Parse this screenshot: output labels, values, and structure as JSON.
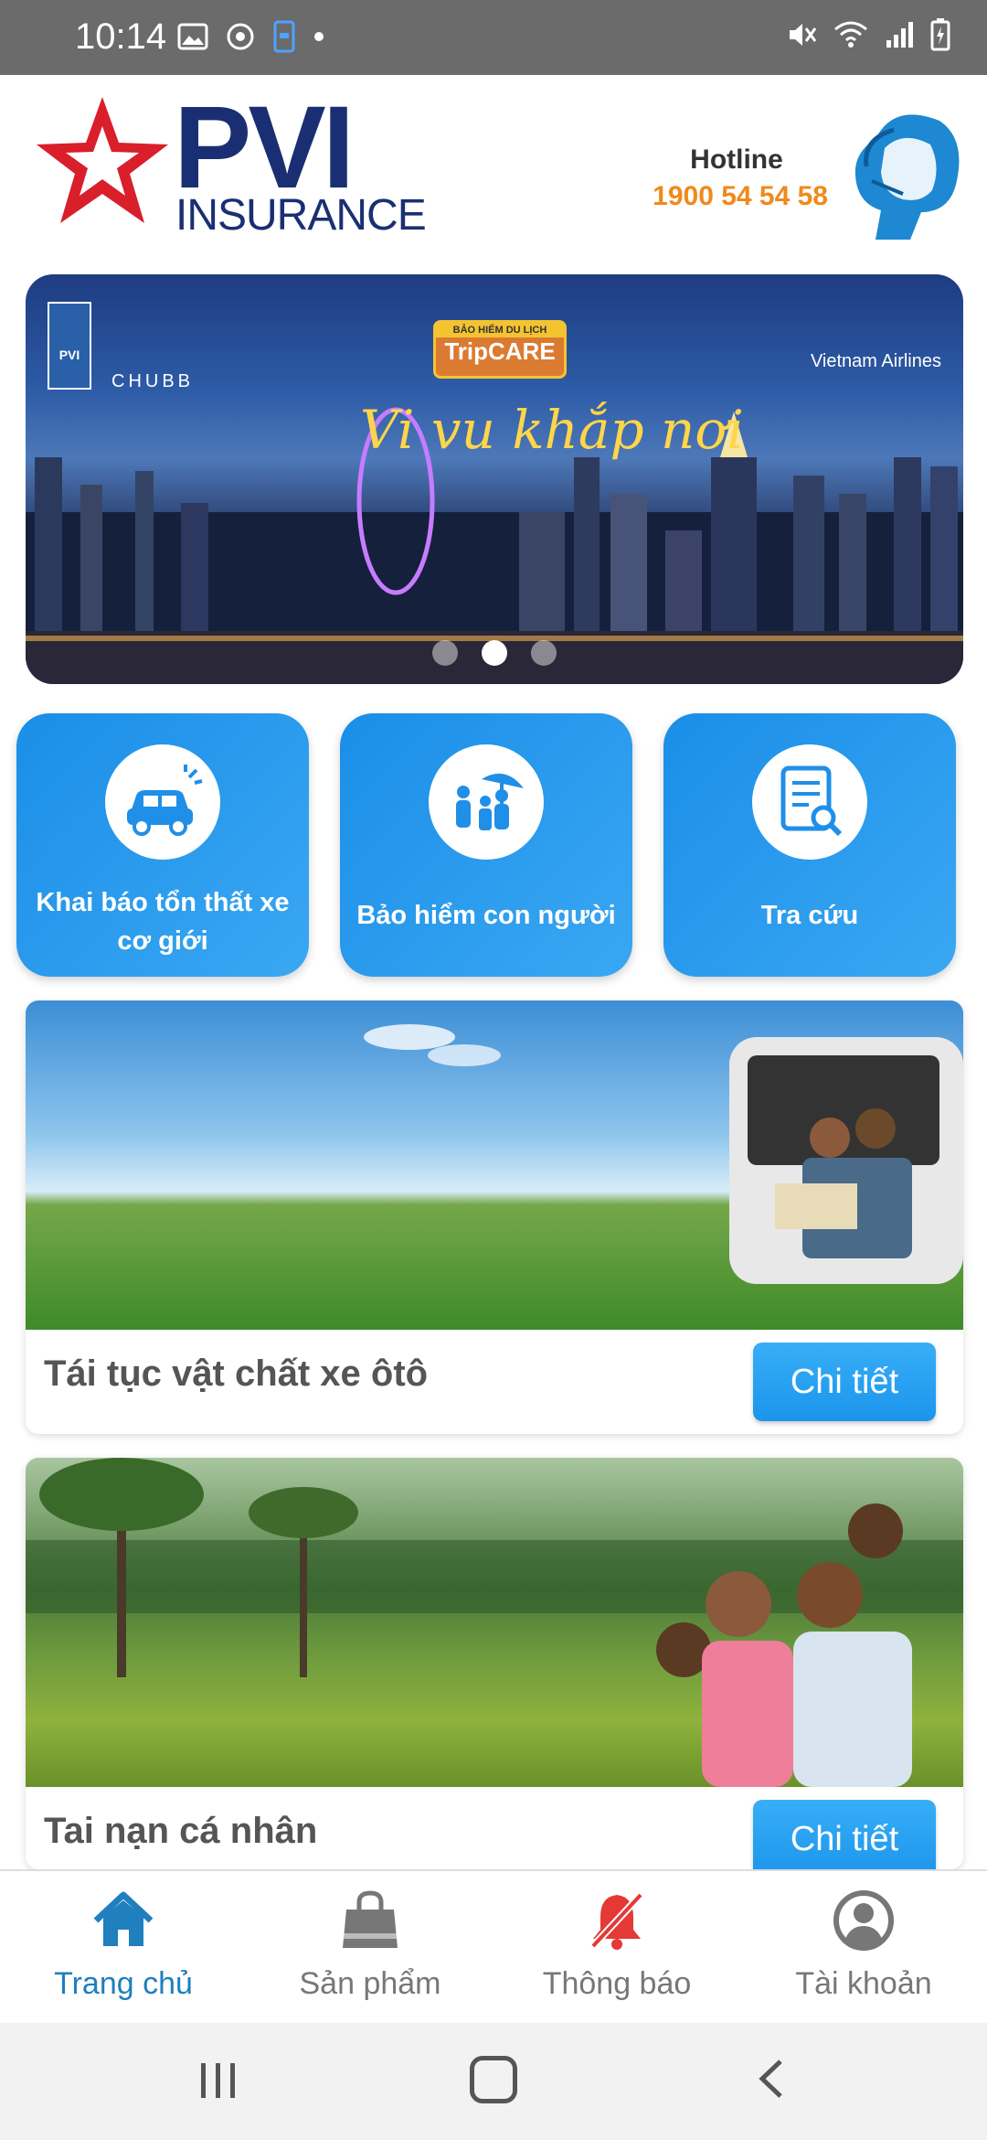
{
  "status_bar": {
    "time": "10:14",
    "icons": [
      "image-icon",
      "sync-icon",
      "phone-link-icon",
      "dot-icon",
      "mute-icon",
      "wifi-icon",
      "signal-icon",
      "battery-icon"
    ]
  },
  "header": {
    "brand_main": "PVI",
    "brand_sub": "INSURANCE",
    "hotline_label": "Hotline",
    "hotline_number": "1900 54 54 58",
    "brand_colors": {
      "navy": "#1a2f73",
      "red": "#d81f2a",
      "orange": "#f08a1c"
    }
  },
  "banner": {
    "partner_left": "CHUBB",
    "badge_small": "BẢO HIỂM DU LỊCH",
    "badge_big": "TripCARE",
    "headline": "Vi vu khắp nơi",
    "partner_right": "Vietnam Airlines",
    "mini_logo": "PVI",
    "slides_total": 3,
    "active_slide": 2
  },
  "tiles": [
    {
      "label": "Khai báo tổn thất xe cơ giới",
      "icon": "car-damage-icon"
    },
    {
      "label": "Bảo hiểm con người",
      "icon": "family-umbrella-icon"
    },
    {
      "label": "Tra cứu",
      "icon": "document-search-icon"
    }
  ],
  "products": [
    {
      "title": "Tái tục vật chất xe ôtô",
      "button": "Chi tiết"
    },
    {
      "title": "Tai nạn cá nhân",
      "button": "Chi tiết"
    }
  ],
  "bottom_nav": [
    {
      "label": "Trang chủ",
      "icon": "home-icon",
      "active": true
    },
    {
      "label": "Sản phẩm",
      "icon": "shopping-bag-icon",
      "active": false
    },
    {
      "label": "Thông báo",
      "icon": "bell-muted-icon",
      "active": false
    },
    {
      "label": "Tài khoản",
      "icon": "account-icon",
      "active": false
    }
  ],
  "colors": {
    "primary": "#1f8fe8",
    "active_nav": "#1f7fbf",
    "inactive_nav": "#777777",
    "notif_red": "#e53935"
  }
}
